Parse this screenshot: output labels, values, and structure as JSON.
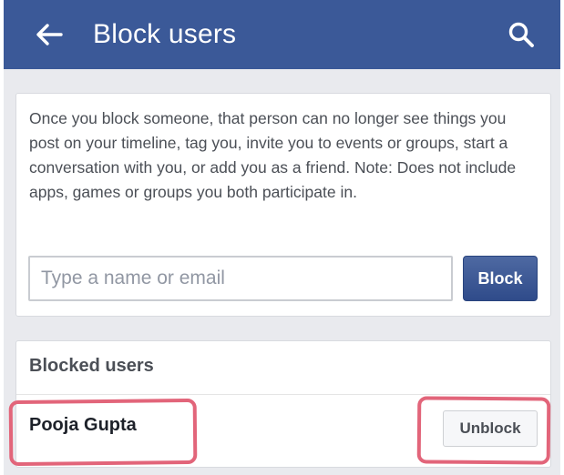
{
  "header": {
    "title": "Block users",
    "back_icon": "arrow-left-icon",
    "search_icon": "search-icon",
    "bar_color": "#3b5998"
  },
  "info": {
    "description": "Once you block someone, that person can no longer see things you post on your timeline, tag you, invite you to events or groups, start a conversation with you, or add you as a friend. Note: Does not include apps, games or groups you both participate in."
  },
  "block_form": {
    "placeholder": "Type a name or email",
    "value": "",
    "button_label": "Block"
  },
  "blocked": {
    "header": "Blocked users",
    "users": [
      {
        "name": "Pooja Gupta",
        "action_label": "Unblock"
      }
    ]
  },
  "annotation_color": "#e2657a"
}
